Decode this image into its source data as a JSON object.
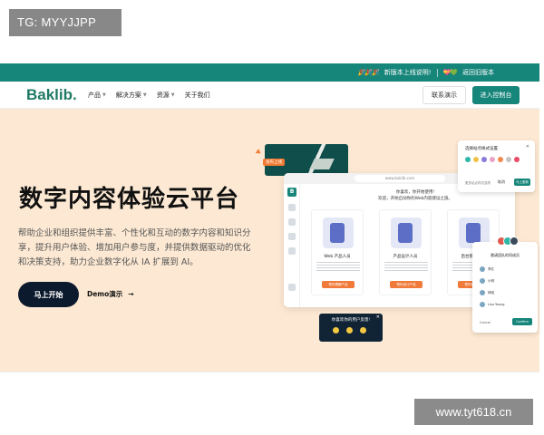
{
  "watermarks": {
    "top_left": "TG: MYYJJPP",
    "bottom_right": "www.tyt618.cn"
  },
  "announcement": {
    "emoji_left": "🎉🎉🎉",
    "new_version": "新版本上线说明!",
    "emoji_right": "💝💚",
    "back_old": "返回旧版本"
  },
  "nav": {
    "logo": "Baklib",
    "logo_dot": ".",
    "items": [
      {
        "label": "产品",
        "dropdown": true
      },
      {
        "label": "解决方案",
        "dropdown": true
      },
      {
        "label": "资源",
        "dropdown": true
      },
      {
        "label": "关于我们",
        "dropdown": false
      }
    ],
    "contact_demo": "联系演示",
    "console": "进入控制台"
  },
  "hero": {
    "title": "数字内容体验云平台",
    "description": "帮助企业和组织提供丰富、个性化和互动的数字内容和知识分享，提升用户体验、增加用户参与度，并提供数据驱动的优化和决策支持，助力企业数字化从 IA 扩展到 AI。",
    "start_button": "马上开始",
    "demo_link": "Demo演示",
    "demo_arrow": "→"
  },
  "mockup": {
    "publish_tag": "发布上线",
    "url": "www.baklib.com",
    "sidebar_logo": "B",
    "greeting_line1": "你喜欢，你开始使用!",
    "greeting_line2": "欢迎，开始启动你的Web内容建设之旅。",
    "cards": [
      {
        "title": "Web 产品人员",
        "button": "帮你理解产品"
      },
      {
        "title": "产品设计人员",
        "button": "帮你设计产品"
      },
      {
        "title": "后台管理人员",
        "button": "帮你管理产品"
      }
    ],
    "style_panel": {
      "title": "选择站点样式设置",
      "close": "✕",
      "label": "更多站点样式选项",
      "cancel": "取消",
      "save": "马上更新",
      "colors": [
        "#2fb7a8",
        "#f0c24a",
        "#8b7ad8",
        "#e7a3c6",
        "#f28a4b",
        "#c4c4c4",
        "#e84c6b"
      ]
    },
    "invite_panel": {
      "title": "邀请团队的同成员",
      "members": [
        "李红",
        "小明",
        "林昭",
        "Lisa Young"
      ],
      "cancel": "Cancel",
      "confirm": "Confirm",
      "avatar_colors": [
        "#e05a4e",
        "#2fb7a8",
        "#3a4a5c"
      ]
    },
    "feedback": {
      "title": "你喜欢你的用户反馈!",
      "close": "✕"
    }
  }
}
